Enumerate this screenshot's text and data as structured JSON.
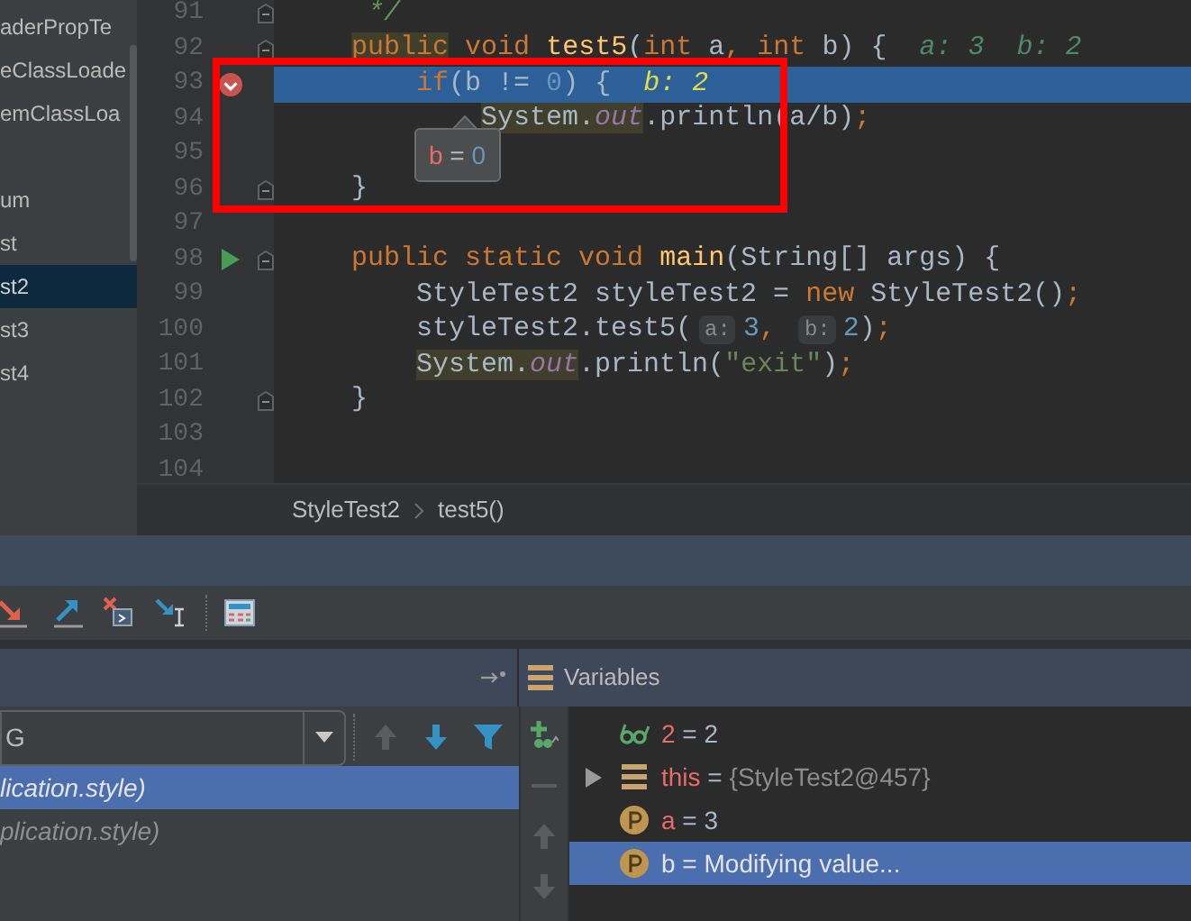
{
  "project_tree": {
    "items": [
      {
        "label": "aderPropTe",
        "selected": false,
        "gap_before": false
      },
      {
        "label": "eClassLoade",
        "selected": false,
        "gap_before": false
      },
      {
        "label": "emClassLoa",
        "selected": false,
        "gap_before": false
      },
      {
        "label": "um",
        "selected": false,
        "gap_before": true
      },
      {
        "label": "st",
        "selected": false,
        "gap_before": false
      },
      {
        "label": "st2",
        "selected": true,
        "gap_before": false
      },
      {
        "label": "st3",
        "selected": false,
        "gap_before": false
      },
      {
        "label": "st4",
        "selected": false,
        "gap_before": false
      }
    ]
  },
  "editor": {
    "lines": [
      {
        "number": "91",
        "current": false,
        "fold": true,
        "tokens": [
          {
            "text": "     */",
            "kind": "comment",
            "highlight": false
          }
        ]
      },
      {
        "number": "92",
        "current": false,
        "fold": true,
        "tokens": [
          {
            "text": "    public",
            "kind": "keyword",
            "highlight": true
          },
          {
            "text": " void",
            "kind": "keyword",
            "highlight": false
          },
          {
            "text": " test5",
            "kind": "method",
            "highlight": false
          },
          {
            "text": "(",
            "kind": "plain",
            "highlight": false
          },
          {
            "text": "int",
            "kind": "keyword",
            "highlight": false
          },
          {
            "text": " a",
            "kind": "plain",
            "highlight": false
          },
          {
            "text": ", int",
            "kind": "keyword",
            "highlight": false
          },
          {
            "text": " b) {",
            "kind": "plain",
            "highlight": false
          },
          {
            "text": "a: 3  b: 2",
            "kind": "value_hint"
          }
        ]
      },
      {
        "number": "93",
        "current": true,
        "fold": false,
        "kind": "breakpoint",
        "tokens": [
          {
            "text": "        if",
            "kind": "keyword",
            "highlight": false
          },
          {
            "text": "(b != ",
            "kind": "plain",
            "highlight": false
          },
          {
            "text": "0",
            "kind": "number",
            "highlight": false
          },
          {
            "text": ") {",
            "kind": "plain",
            "highlight": false
          },
          {
            "text": "b: 2",
            "kind": "value_hint_current"
          }
        ]
      },
      {
        "number": "94",
        "current": false,
        "fold": false,
        "tokens": [
          {
            "text": "            System.",
            "kind": "plain",
            "highlight": true
          },
          {
            "text": "out",
            "kind": "field",
            "highlight": true
          },
          {
            "text": ".println(a/b)",
            "kind": "plain",
            "highlight": false
          },
          {
            "text": ";",
            "kind": "keyword",
            "highlight": false
          }
        ]
      },
      {
        "number": "95",
        "current": false,
        "fold": false
      },
      {
        "number": "96",
        "current": false,
        "fold": true,
        "tokens": [
          {
            "text": "    }",
            "kind": "plain",
            "highlight": false
          }
        ]
      },
      {
        "number": "97",
        "current": false,
        "fold": false
      },
      {
        "number": "98",
        "current": false,
        "fold": true,
        "kind": "run",
        "tokens": [
          {
            "text": "    public static void",
            "kind": "keyword",
            "highlight": false
          },
          {
            "text": " main",
            "kind": "method",
            "highlight": false
          },
          {
            "text": "(String[] args) {",
            "kind": "plain",
            "highlight": false
          }
        ]
      },
      {
        "number": "99",
        "current": false,
        "fold": false,
        "tokens": [
          {
            "text": "        StyleTest2 styleTest2 = ",
            "kind": "plain",
            "highlight": false
          },
          {
            "text": "new",
            "kind": "keyword",
            "highlight": false
          },
          {
            "text": " StyleTest2()",
            "kind": "plain",
            "highlight": false
          },
          {
            "text": ";",
            "kind": "keyword",
            "highlight": false
          }
        ]
      },
      {
        "number": "100",
        "current": false,
        "fold": false,
        "tokens": [
          {
            "text": "        styleTest2.test5(",
            "kind": "plain",
            "highlight": false
          },
          {
            "text": "a:",
            "kind": "inlay"
          },
          {
            "text": "3",
            "kind": "number",
            "highlight": false
          },
          {
            "text": ", ",
            "kind": "keyword",
            "highlight": false
          },
          {
            "text": "b:",
            "kind": "inlay"
          },
          {
            "text": "2",
            "kind": "number",
            "highlight": false
          },
          {
            "text": ")",
            "kind": "plain",
            "highlight": false
          },
          {
            "text": ";",
            "kind": "keyword",
            "highlight": false
          }
        ]
      },
      {
        "number": "101",
        "current": false,
        "fold": false,
        "tokens": [
          {
            "text": "        System.",
            "kind": "plain",
            "highlight": true
          },
          {
            "text": "out",
            "kind": "field",
            "highlight": true
          },
          {
            "text": ".println(",
            "kind": "plain",
            "highlight": false
          },
          {
            "text": "\"exit\"",
            "kind": "string",
            "highlight": false
          },
          {
            "text": ")",
            "kind": "plain",
            "highlight": false
          },
          {
            "text": ";",
            "kind": "keyword",
            "highlight": false
          }
        ]
      },
      {
        "number": "102",
        "current": false,
        "fold": true,
        "tokens": [
          {
            "text": "    }",
            "kind": "plain",
            "highlight": false
          }
        ]
      },
      {
        "number": "103",
        "current": false,
        "fold": false
      },
      {
        "number": "104",
        "current": false,
        "fold": false
      }
    ]
  },
  "value_tooltip": {
    "name": "b",
    "separator": "=",
    "value": "0"
  },
  "breadcrumbs": [
    "StyleTest2",
    "test5()"
  ],
  "frames": {
    "thread_dropdown": "G",
    "items": [
      {
        "label": "lication.style)",
        "selected": true
      },
      {
        "label": "plication.style)",
        "selected": false
      }
    ]
  },
  "variables": {
    "title": "Variables",
    "items": [
      {
        "kind": "watch",
        "name": "2",
        "separator": "=",
        "value": "2",
        "has_children": false,
        "selected": false
      },
      {
        "kind": "object",
        "name": "this",
        "separator": "=",
        "value": "{StyleTest2@457}",
        "has_children": true,
        "selected": false
      },
      {
        "kind": "parameter",
        "name": "a",
        "separator": "=",
        "value": "3",
        "has_children": false,
        "selected": false
      },
      {
        "kind": "parameter",
        "name": "b",
        "separator": "=",
        "value": "Modifying value...",
        "has_children": false,
        "selected": true
      }
    ]
  }
}
